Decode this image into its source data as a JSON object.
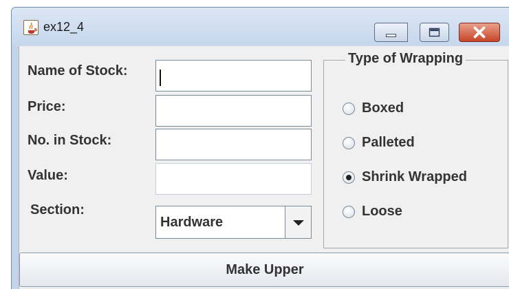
{
  "window": {
    "title": "ex12_4",
    "icon": "java-cup-icon",
    "controls": [
      "minimize-icon",
      "maximize-icon",
      "close-icon"
    ]
  },
  "form": {
    "labels": {
      "name": "Name of Stock:",
      "price": "Price:",
      "stock": "No. in Stock:",
      "value": "Value:",
      "section": "Section:"
    },
    "values": {
      "name": "",
      "price": "",
      "stock": "",
      "value": ""
    },
    "section_selected": "Hardware"
  },
  "wrapping": {
    "title": "Type of Wrapping",
    "options": [
      {
        "label": "Boxed",
        "selected": false
      },
      {
        "label": "Palleted",
        "selected": false
      },
      {
        "label": "Shrink Wrapped",
        "selected": true
      },
      {
        "label": "Loose",
        "selected": false
      }
    ]
  },
  "actions": {
    "make_upper_label": "Make Upper"
  },
  "colors": {
    "titlebar": "#c6d6ec",
    "close_button": "#c7452a",
    "panel": "#f0f0f0"
  }
}
